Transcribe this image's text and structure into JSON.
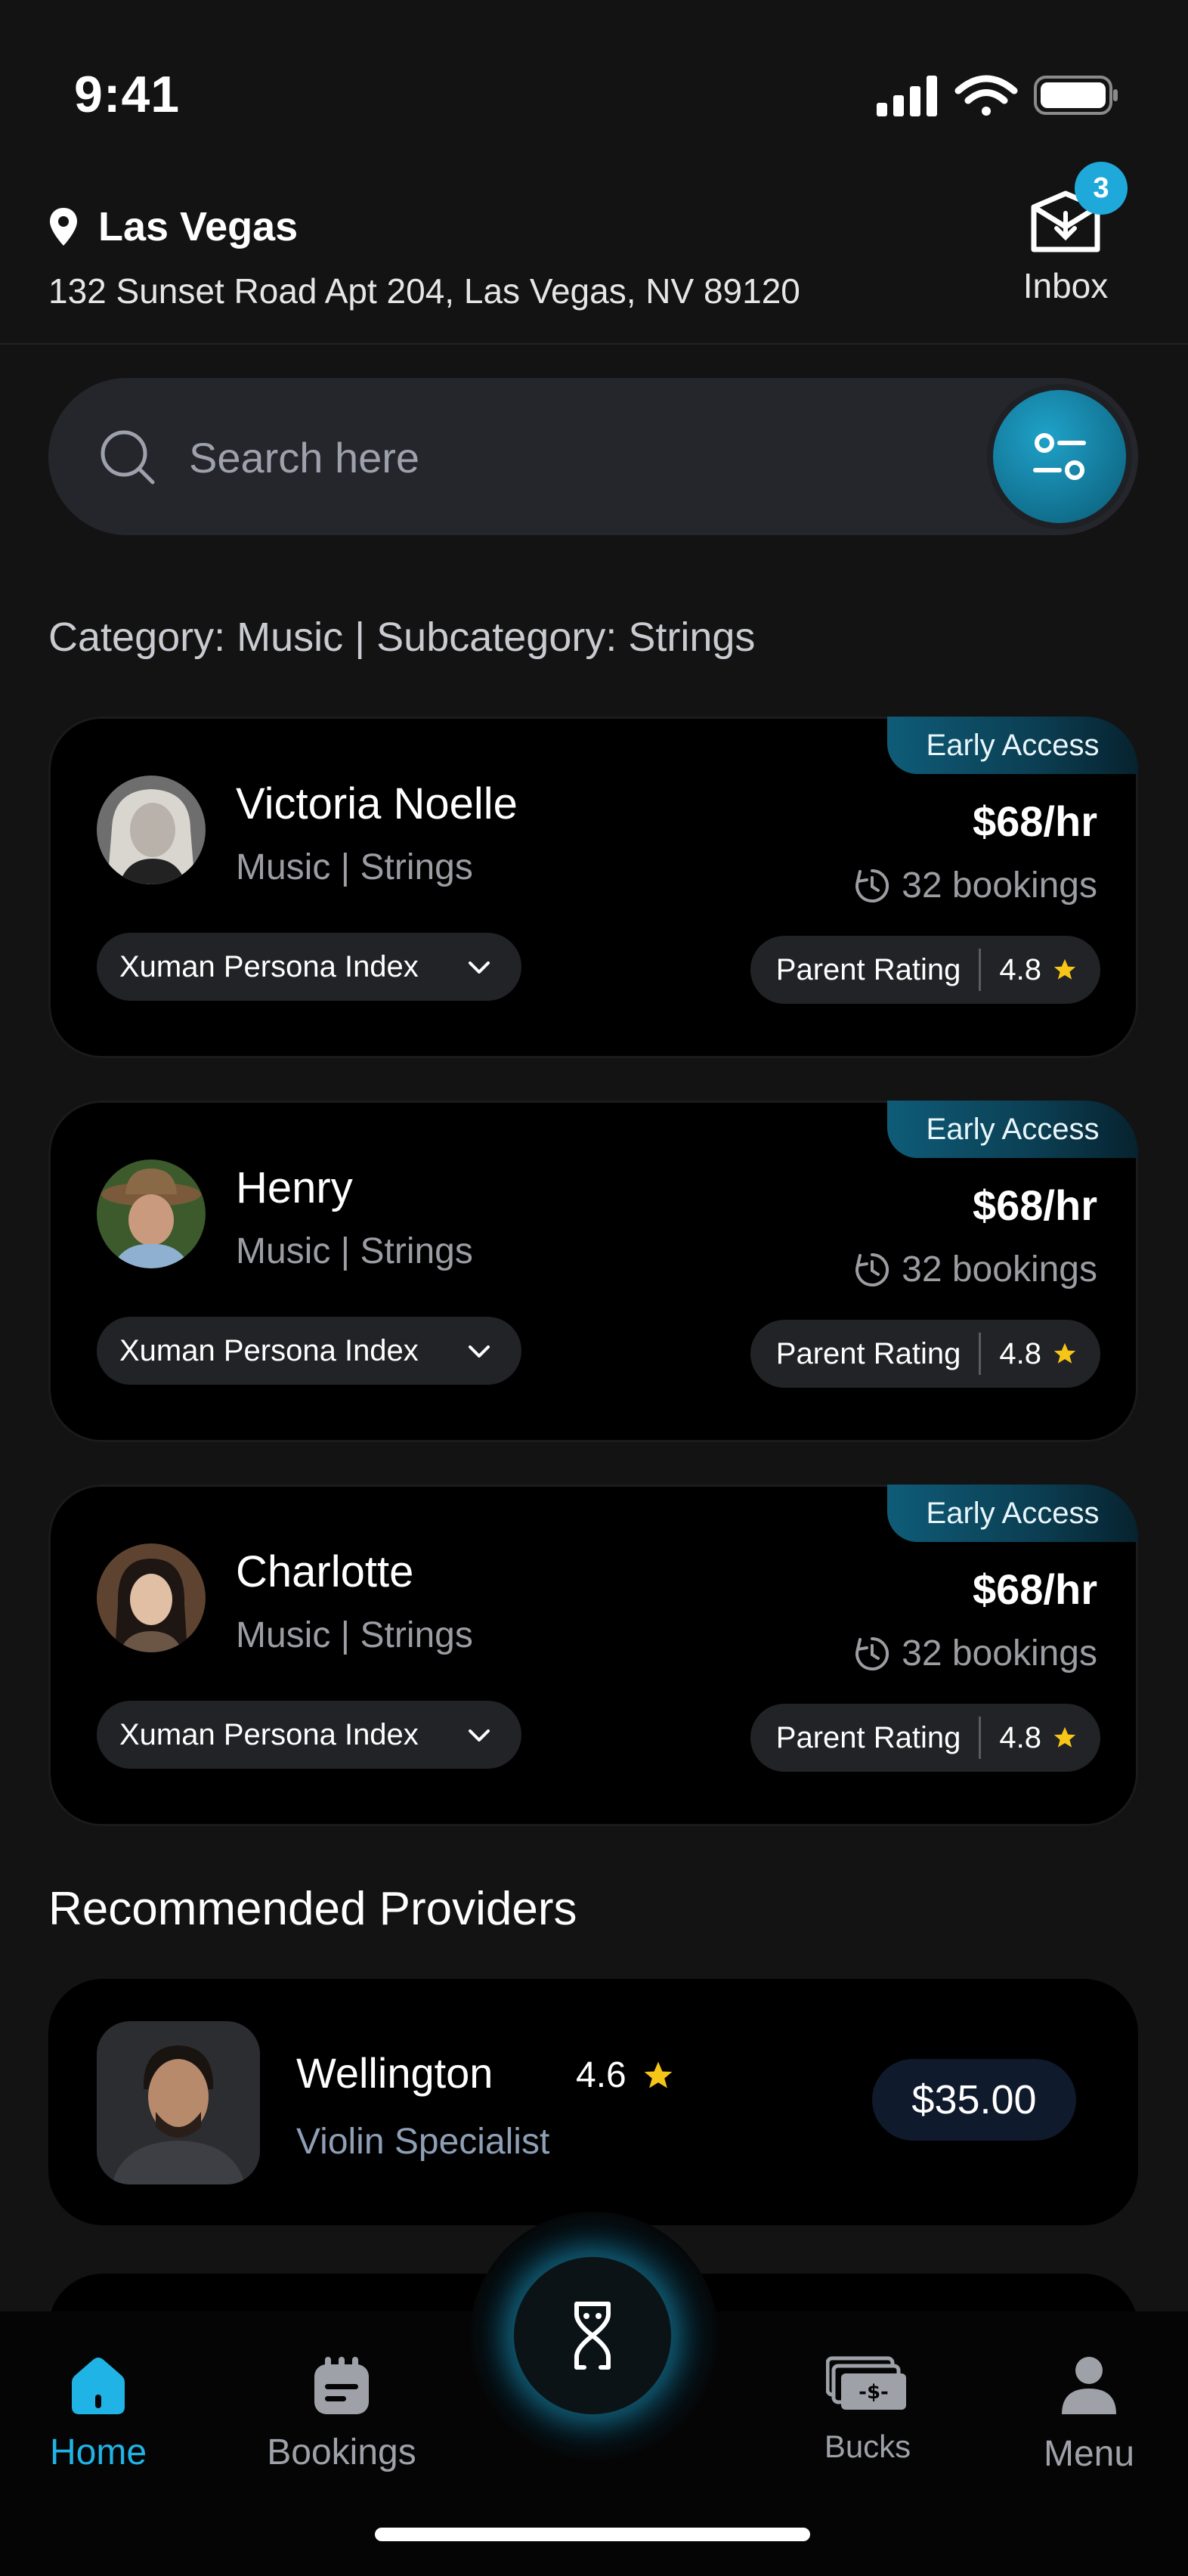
{
  "status_bar": {
    "time": "9:41"
  },
  "header": {
    "city": "Las Vegas",
    "address": "132 Sunset Road Apt 204, Las Vegas, NV 89120",
    "inbox_label": "Inbox",
    "inbox_count": "3"
  },
  "search": {
    "placeholder": "Search here"
  },
  "category_line": "Category: Music | Subcategory: Strings",
  "providers": [
    {
      "badge": "Early Access",
      "name": "Victoria Noelle",
      "subtitle": "Music | Strings",
      "price": "$68/hr",
      "bookings": "32 bookings",
      "persona_label": "Xuman Persona Index",
      "rating_label": "Parent Rating",
      "rating": "4.8"
    },
    {
      "badge": "Early Access",
      "name": "Henry",
      "subtitle": "Music | Strings",
      "price": "$68/hr",
      "bookings": "32 bookings",
      "persona_label": "Xuman Persona Index",
      "rating_label": "Parent Rating",
      "rating": "4.8"
    },
    {
      "badge": "Early Access",
      "name": "Charlotte",
      "subtitle": "Music | Strings",
      "price": "$68/hr",
      "bookings": "32 bookings",
      "persona_label": "Xuman Persona Index",
      "rating_label": "Parent Rating",
      "rating": "4.8"
    }
  ],
  "recommended": {
    "title": "Recommended Providers",
    "items": [
      {
        "name": "Wellington",
        "rating": "4.6",
        "subtitle": "Violin Specialist",
        "price": "$35.00"
      }
    ]
  },
  "tabbar": {
    "home": "Home",
    "bookings": "Bookings",
    "bucks": "Bucks",
    "menu": "Menu"
  },
  "colors": {
    "accent": "#20b3e6",
    "background": "#131314",
    "card": "#000000",
    "star": "#f5c518"
  }
}
